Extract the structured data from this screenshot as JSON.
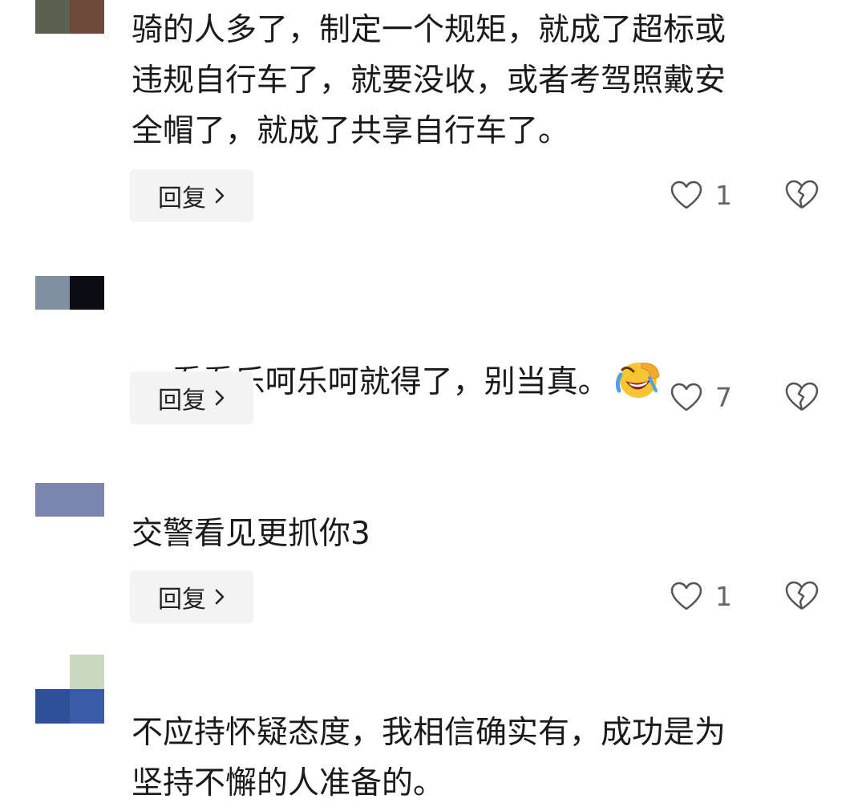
{
  "comments": [
    {
      "username": "",
      "avatar_colors": [
        "#5a6150",
        "#6e4a3a"
      ],
      "text": "骑的人多了，制定一个规矩，就成了超标或\n违规自行车了，就要没收，或者考驾照戴安\n全帽了，就成了共享自行车了。",
      "emoji": "",
      "reply_label": "回复",
      "like_count": "1"
    },
    {
      "username": "",
      "avatar_colors": [
        "#8090a0",
        "#0b0b12"
      ],
      "text": "看看乐呵乐呵就得了，别当真。",
      "emoji": "rolling-laughing-emoji",
      "reply_label": "回复",
      "like_count": "7"
    },
    {
      "username": "",
      "avatar_colors": [
        "#7b85ad",
        "#7b85ad"
      ],
      "text": "交警看见更抓你3",
      "emoji": "",
      "reply_label": "回复",
      "like_count": "1"
    },
    {
      "username": "",
      "avatar_colors": [
        "#2f4f99",
        "#c9d9bd"
      ],
      "text": "不应持怀疑态度，我相信确实有，成功是为\n坚持不懈的人准备的。",
      "emoji": "",
      "reply_label": "",
      "like_count": ""
    }
  ],
  "icons": {
    "like": "heart-outline-icon",
    "dislike": "broken-heart-icon",
    "reply_chevron": "chevron-right-icon"
  },
  "colors": {
    "text": "#1a1a1a",
    "button_bg": "#f3f3f3",
    "icon": "#555555"
  }
}
